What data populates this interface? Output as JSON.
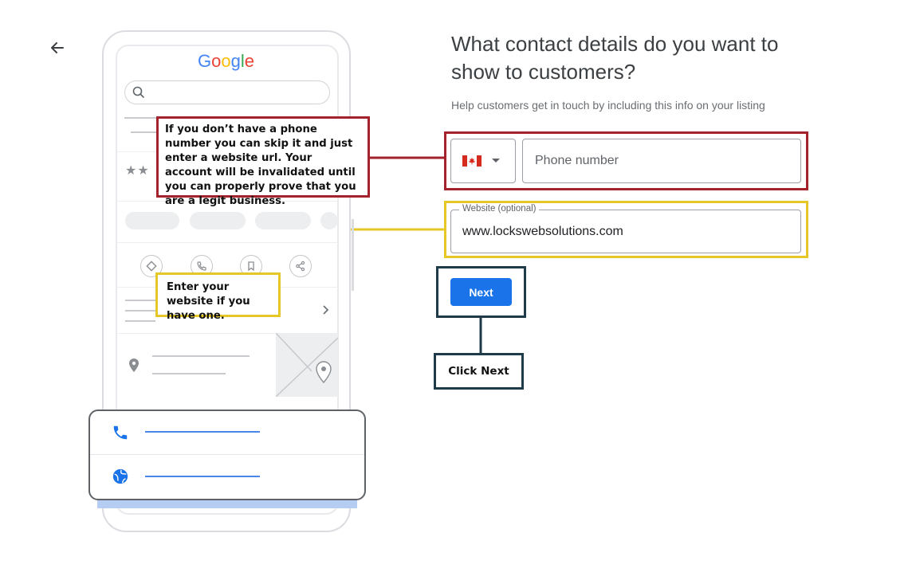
{
  "header": {
    "back_icon": "arrow-left-icon",
    "title": "What contact details do you want to show to customers?",
    "subtitle": "Help customers get in touch by including this info on your listing"
  },
  "form": {
    "country": {
      "flag": "canada-flag-icon",
      "dropdown_icon": "caret-down-icon"
    },
    "phone": {
      "placeholder": "Phone number",
      "value": ""
    },
    "website": {
      "label": "Website (optional)",
      "value": "www.lockswebsolutions.com"
    },
    "next_label": "Next"
  },
  "preview": {
    "logo_text": "Google",
    "logo_letters": [
      {
        "char": "G",
        "color": "#4285F4"
      },
      {
        "char": "o",
        "color": "#EA4335"
      },
      {
        "char": "o",
        "color": "#FBBC05"
      },
      {
        "char": "g",
        "color": "#4285F4"
      },
      {
        "char": "l",
        "color": "#34A853"
      },
      {
        "char": "e",
        "color": "#EA4335"
      }
    ],
    "card_icons": [
      "phone-icon",
      "globe-icon"
    ]
  },
  "annotations": {
    "phone_note": "If you don’t have a phone number you can skip it and just enter a website url. Your account will be invalidated until you can properly prove that you are a legit business.",
    "website_note": "Enter your website if you have one.",
    "next_note": "Click Next"
  },
  "colors": {
    "primary": "#1a73e8",
    "annotation_red": "#a3222c",
    "annotation_yellow": "#e5c827",
    "annotation_dark": "#1f3a48"
  }
}
